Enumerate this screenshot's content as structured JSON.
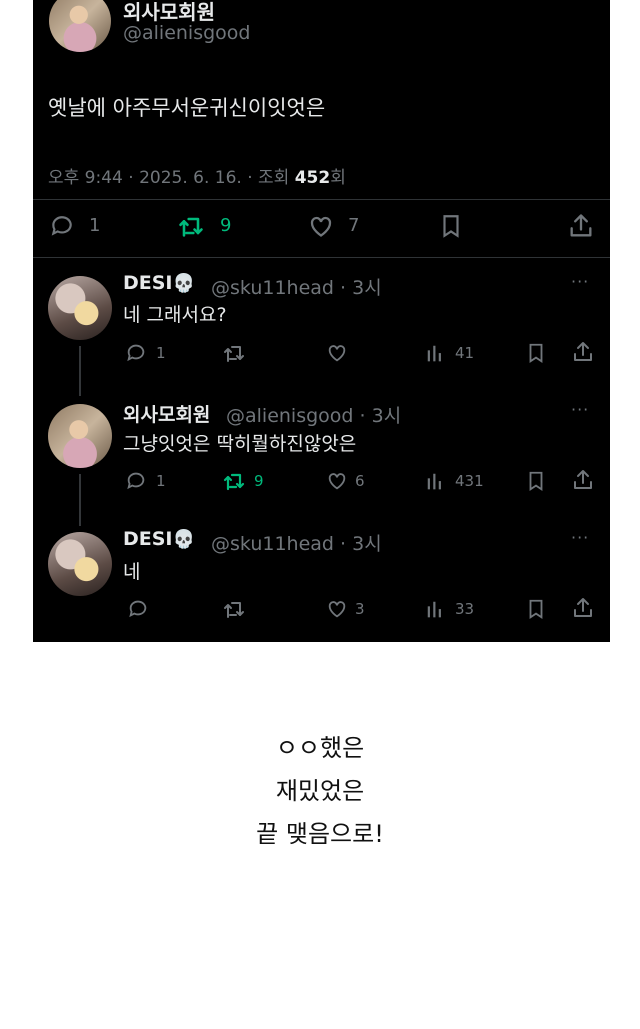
{
  "main_tweet": {
    "name": "외사모회원",
    "handle": "@alienisgood",
    "text": "옛날에 아주무서운귀신이잇엇은",
    "time": "오후 9:44 · 2025. 6. 16. · 조회",
    "views": "452",
    "views_suffix": "회",
    "replies": "1",
    "retweets": "9",
    "likes": "7"
  },
  "replies": [
    {
      "name": "DESI",
      "emoji": "💀",
      "handle": "@sku11head",
      "time": "· 3시",
      "text": "네 그래서요?",
      "replies": "1",
      "retweets": "",
      "likes": "",
      "views": "41"
    },
    {
      "name": "외사모회원",
      "emoji": "",
      "handle": "@alienisgood",
      "time": "· 3시",
      "text": "그냥잇엇은 딱히뭘하진않앗은",
      "replies": "1",
      "retweets": "9",
      "likes": "6",
      "views": "431"
    },
    {
      "name": "DESI",
      "emoji": "💀",
      "handle": "@sku11head",
      "time": "· 3시",
      "text": "네",
      "replies": "",
      "retweets": "",
      "likes": "3",
      "views": "33"
    }
  ],
  "more_label": "···",
  "caption_lines": [
    "ㅇㅇ했은",
    "재밌었은",
    "끝 맺음으로!"
  ],
  "colors": {
    "background": "#000000",
    "text": "#e7e9ea",
    "muted": "#71767b",
    "retweet_active": "#00ba7c"
  }
}
